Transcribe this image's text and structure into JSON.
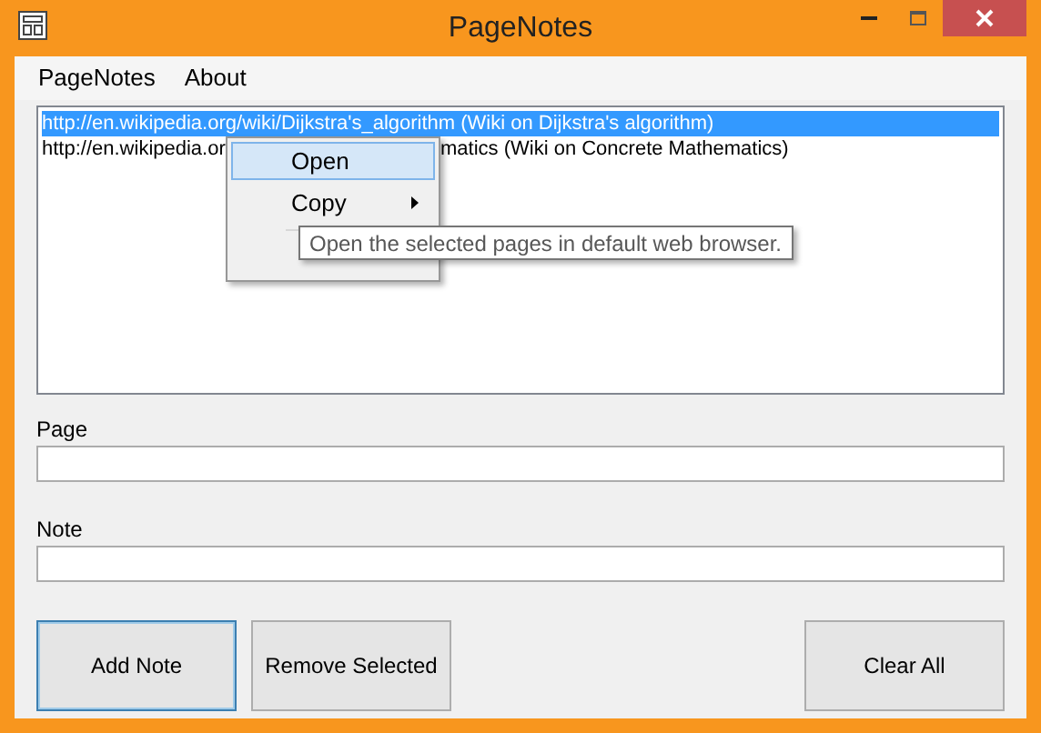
{
  "window": {
    "title": "PageNotes"
  },
  "menu_bar": [
    {
      "label": "PageNotes"
    },
    {
      "label": "About"
    }
  ],
  "list": [
    {
      "text_start": "http://en.wikipedia.org/wiki/Dijkstra's_algorithm (Wiki on Dijkstra's algorithm)",
      "selected": true
    },
    {
      "text_start": "http://en.wikipedia.or",
      "text_end": "matics (Wiki on Concrete Mathematics)",
      "selected": false
    }
  ],
  "context_menu": [
    {
      "label": "Open",
      "selected": true,
      "submenu": false
    },
    {
      "label": "Copy",
      "selected": false,
      "submenu": true
    }
  ],
  "tooltip": "Open the selected pages in default web browser.",
  "fields": [
    {
      "label": "Page"
    },
    {
      "label": "Note"
    }
  ],
  "buttons": [
    {
      "label": "Add Note",
      "focused": true
    },
    {
      "label": "Remove Selected",
      "focused": false
    },
    {
      "label": "Clear All",
      "focused": false
    }
  ]
}
